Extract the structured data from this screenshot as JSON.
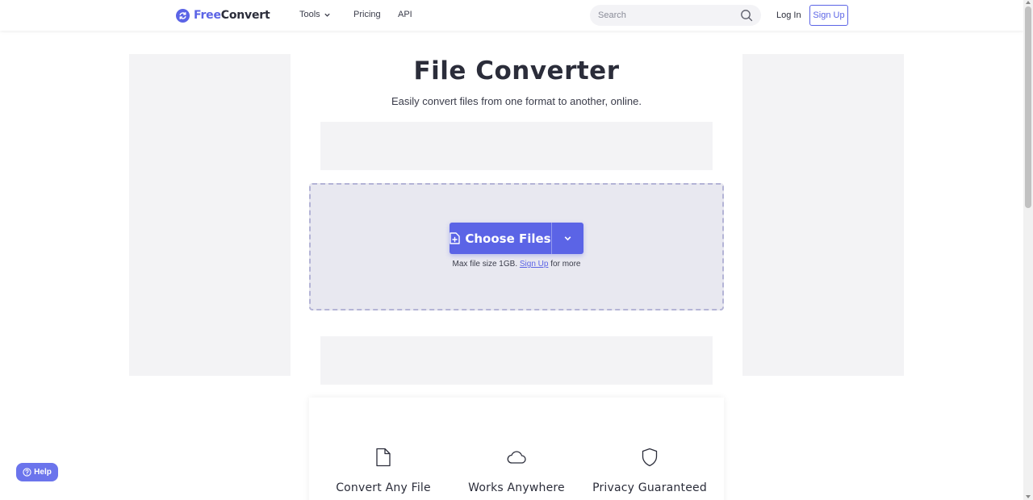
{
  "brand": {
    "name_part1": "Free",
    "name_part2": "Convert",
    "accent_color": "#5b64e6"
  },
  "nav": {
    "tools": "Tools",
    "pricing": "Pricing",
    "api": "API"
  },
  "search": {
    "placeholder": "Search"
  },
  "auth": {
    "login": "Log In",
    "signup": "Sign Up"
  },
  "hero": {
    "title": "File Converter",
    "subtitle": "Easily convert files from one format to another, online."
  },
  "upload": {
    "choose_label": "Choose Files",
    "max_prefix": "Max file size 1GB.",
    "signup_link": "Sign Up",
    "max_suffix": "for more"
  },
  "features": [
    {
      "label": "Convert Any File",
      "icon": "file-icon"
    },
    {
      "label": "Works Anywhere",
      "icon": "cloud-icon"
    },
    {
      "label": "Privacy Guaranteed",
      "icon": "shield-icon"
    }
  ],
  "help": {
    "label": "Help"
  }
}
